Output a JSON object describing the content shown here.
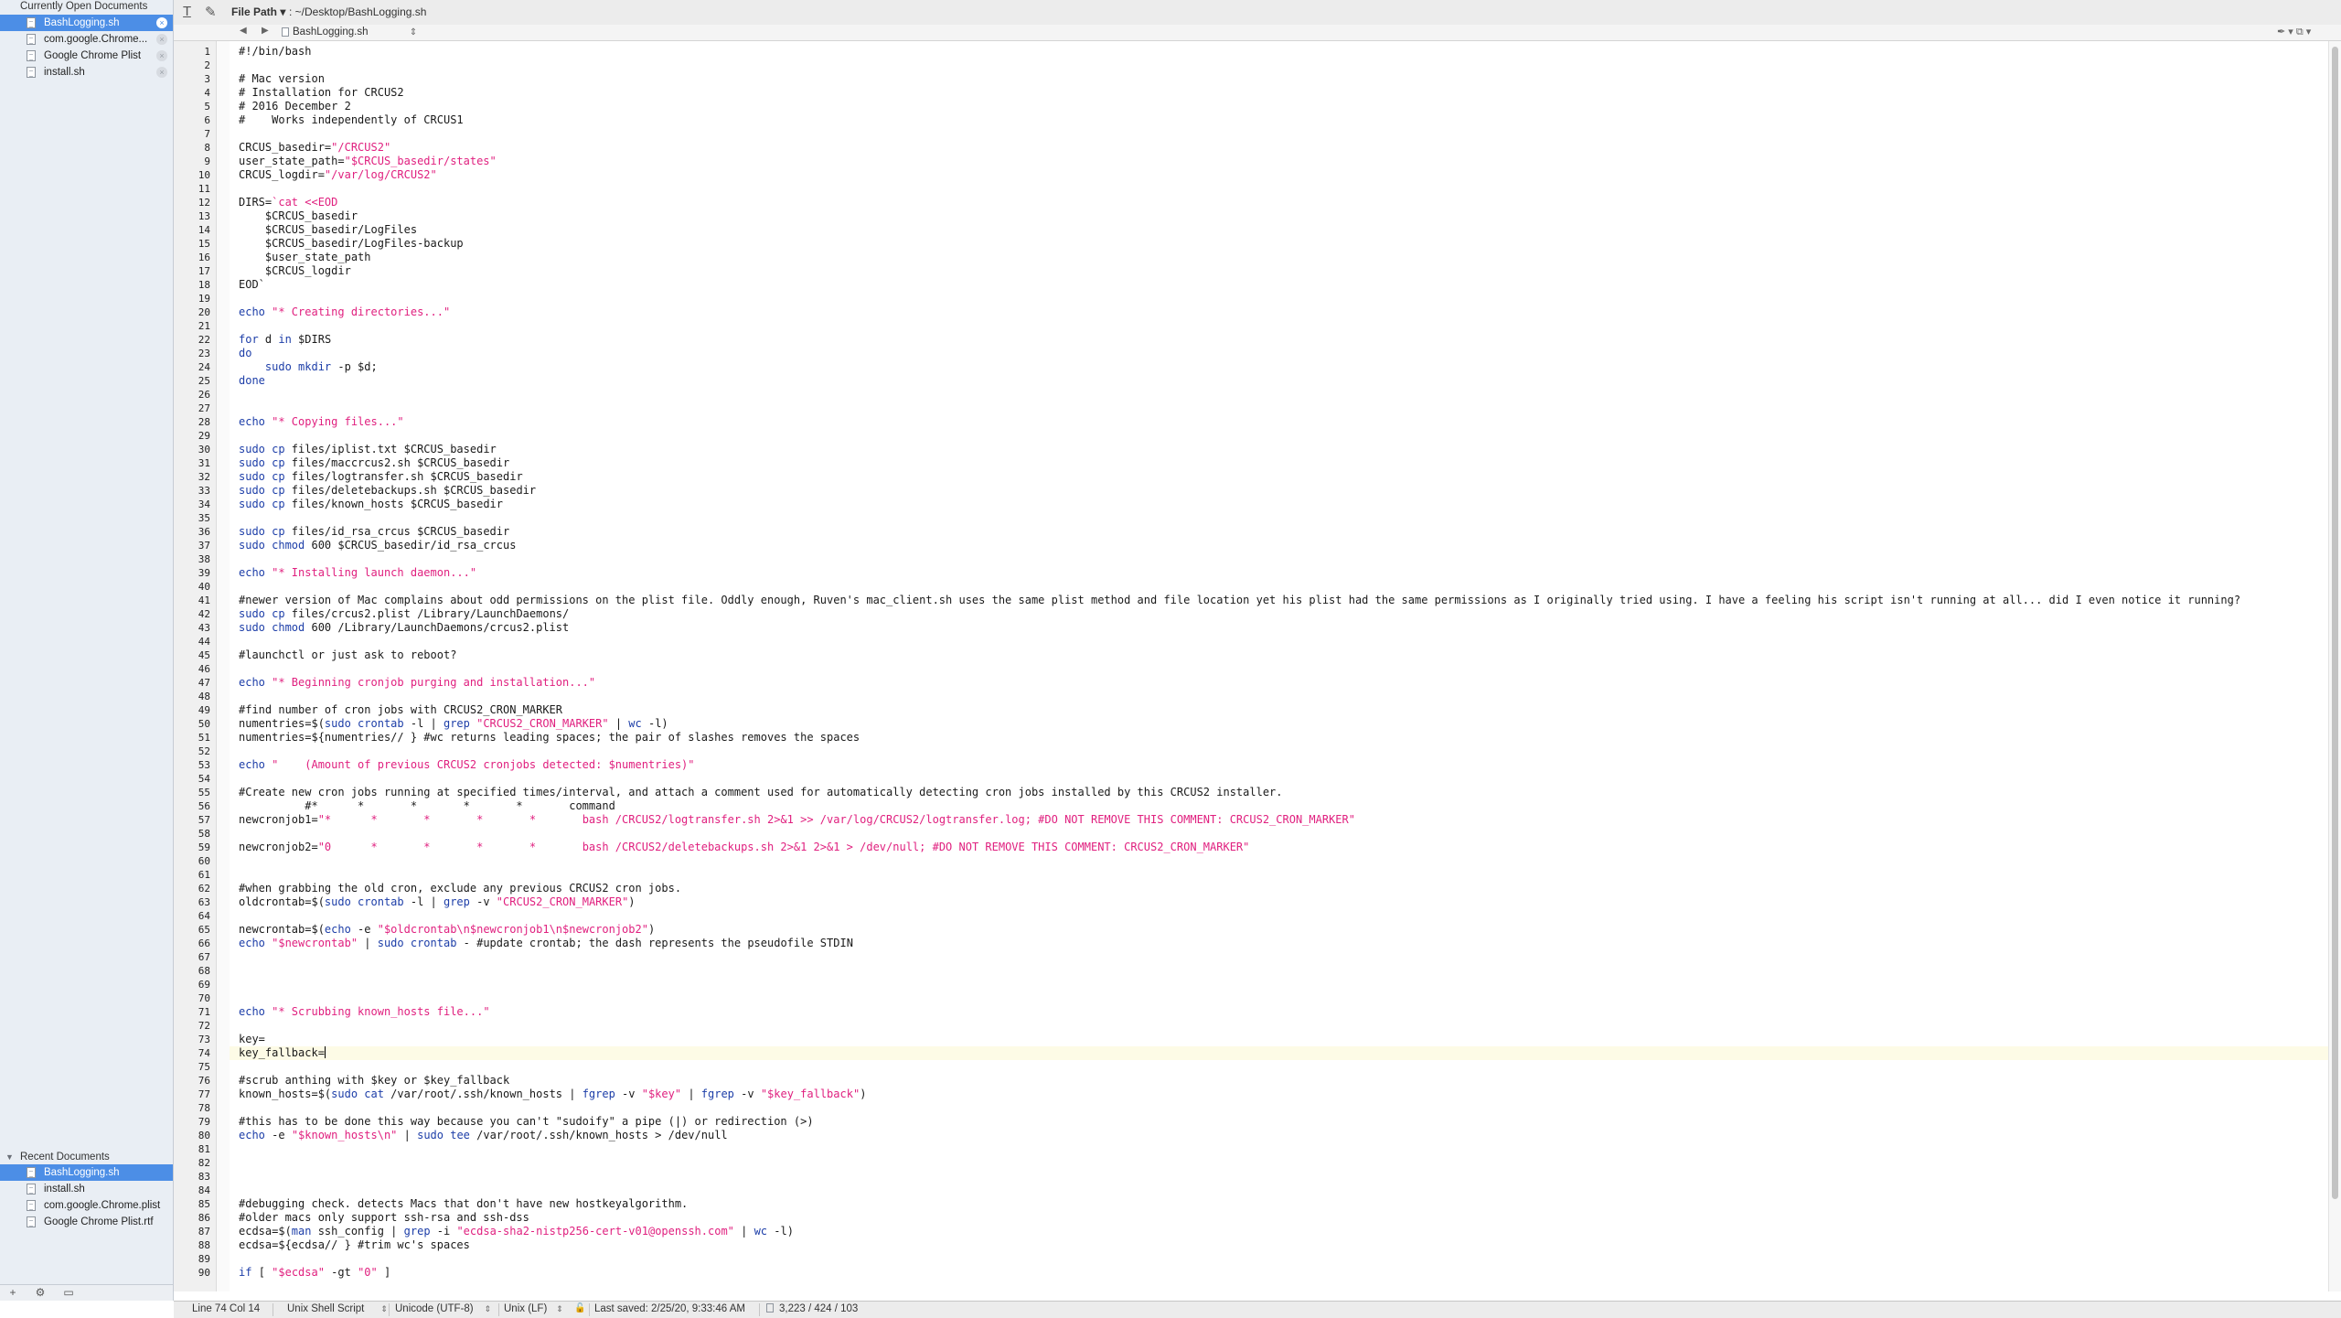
{
  "sidebar": {
    "open_header": "Currently Open Documents",
    "open_documents": [
      {
        "name": "BashLogging.sh",
        "selected": true
      },
      {
        "name": "com.google.Chrome...",
        "selected": false
      },
      {
        "name": "Google Chrome Plist",
        "selected": false
      },
      {
        "name": "install.sh",
        "selected": false
      }
    ],
    "recent_header": "Recent Documents",
    "recent_documents": [
      {
        "name": "BashLogging.sh",
        "selected": true
      },
      {
        "name": "install.sh",
        "selected": false
      },
      {
        "name": "com.google.Chrome.plist",
        "selected": false
      },
      {
        "name": "Google Chrome Plist.rtf",
        "selected": false
      }
    ],
    "footer": {
      "add": "+",
      "gear": "⚙︎",
      "view": "▭"
    }
  },
  "toolbar": {
    "path_label": "File Path ▾",
    "path_value": ": ~/Desktop/BashLogging.sh",
    "text_icon": "T̲",
    "doc_icon": "✎"
  },
  "navbar": {
    "back": "◀",
    "forward": "▶",
    "file_name": "BashLogging.sh",
    "file_menu": "⇕",
    "right_icons": "✒ ▾  ⧉ ▾"
  },
  "editor": {
    "current_line_index": 73,
    "lines": [
      {
        "text": "#!/bin/bash"
      },
      {
        "text": ""
      },
      {
        "text": "# Mac version"
      },
      {
        "text": "# Installation for CRCUS2"
      },
      {
        "text": "# 2016 December 2"
      },
      {
        "text": "#    Works independently of CRCUS1"
      },
      {
        "text": ""
      },
      {
        "segs": [
          [
            "",
            "CRCUS_basedir="
          ],
          [
            "str",
            "\"/CRCUS2\""
          ]
        ]
      },
      {
        "segs": [
          [
            "",
            "user_state_path="
          ],
          [
            "str",
            "\"$CRCUS_basedir/states\""
          ]
        ]
      },
      {
        "segs": [
          [
            "",
            "CRCUS_logdir="
          ],
          [
            "str",
            "\"/var/log/CRCUS2\""
          ]
        ]
      },
      {
        "text": ""
      },
      {
        "segs": [
          [
            "",
            "DIRS="
          ],
          [
            "str",
            "`cat <<EOD"
          ]
        ]
      },
      {
        "text": "    $CRCUS_basedir"
      },
      {
        "text": "    $CRCUS_basedir/LogFiles"
      },
      {
        "text": "    $CRCUS_basedir/LogFiles-backup"
      },
      {
        "text": "    $user_state_path"
      },
      {
        "text": "    $CRCUS_logdir"
      },
      {
        "text": "EOD`"
      },
      {
        "text": ""
      },
      {
        "segs": [
          [
            "kw",
            "echo "
          ],
          [
            "str",
            "\"* Creating directories...\""
          ]
        ]
      },
      {
        "text": ""
      },
      {
        "segs": [
          [
            "kw",
            "for "
          ],
          [
            "",
            "d "
          ],
          [
            "kw",
            "in "
          ],
          [
            "",
            "$DIRS"
          ]
        ]
      },
      {
        "segs": [
          [
            "kw",
            "do"
          ]
        ]
      },
      {
        "segs": [
          [
            "",
            "    "
          ],
          [
            "kw",
            "sudo mkdir"
          ],
          [
            "",
            " -p $d;"
          ]
        ]
      },
      {
        "segs": [
          [
            "kw",
            "done"
          ]
        ]
      },
      {
        "text": ""
      },
      {
        "text": ""
      },
      {
        "segs": [
          [
            "kw",
            "echo "
          ],
          [
            "str",
            "\"* Copying files...\""
          ]
        ]
      },
      {
        "text": ""
      },
      {
        "segs": [
          [
            "kw",
            "sudo cp"
          ],
          [
            "",
            " files/iplist.txt $CRCUS_basedir"
          ]
        ]
      },
      {
        "segs": [
          [
            "kw",
            "sudo cp"
          ],
          [
            "",
            " files/maccrcus2.sh $CRCUS_basedir"
          ]
        ]
      },
      {
        "segs": [
          [
            "kw",
            "sudo cp"
          ],
          [
            "",
            " files/logtransfer.sh $CRCUS_basedir"
          ]
        ]
      },
      {
        "segs": [
          [
            "kw",
            "sudo cp"
          ],
          [
            "",
            " files/deletebackups.sh $CRCUS_basedir"
          ]
        ]
      },
      {
        "segs": [
          [
            "kw",
            "sudo cp"
          ],
          [
            "",
            " files/known_hosts $CRCUS_basedir"
          ]
        ]
      },
      {
        "text": ""
      },
      {
        "segs": [
          [
            "kw",
            "sudo cp"
          ],
          [
            "",
            " files/id_rsa_crcus $CRCUS_basedir"
          ]
        ]
      },
      {
        "segs": [
          [
            "kw",
            "sudo chmod"
          ],
          [
            "",
            " 600 $CRCUS_basedir/id_rsa_crcus"
          ]
        ]
      },
      {
        "text": ""
      },
      {
        "segs": [
          [
            "kw",
            "echo "
          ],
          [
            "str",
            "\"* Installing launch daemon...\""
          ]
        ]
      },
      {
        "text": ""
      },
      {
        "text": "#newer version of Mac complains about odd permissions on the plist file. Oddly enough, Ruven's mac_client.sh uses the same plist method and file location yet his plist had the same permissions as I originally tried using. I have a feeling his script isn't running at all... did I even notice it running?"
      },
      {
        "segs": [
          [
            "kw",
            "sudo cp"
          ],
          [
            "",
            " files/crcus2.plist /Library/LaunchDaemons/"
          ]
        ]
      },
      {
        "segs": [
          [
            "kw",
            "sudo chmod"
          ],
          [
            "",
            " 600 /Library/LaunchDaemons/crcus2.plist"
          ]
        ]
      },
      {
        "text": ""
      },
      {
        "text": "#launchctl or just ask to reboot?"
      },
      {
        "text": ""
      },
      {
        "segs": [
          [
            "kw",
            "echo "
          ],
          [
            "str",
            "\"* Beginning cronjob purging and installation...\""
          ]
        ]
      },
      {
        "text": ""
      },
      {
        "text": "#find number of cron jobs with CRCUS2_CRON_MARKER"
      },
      {
        "segs": [
          [
            "",
            "numentries=$("
          ],
          [
            "kw",
            "sudo crontab"
          ],
          [
            "",
            " -l | "
          ],
          [
            "kw",
            "grep "
          ],
          [
            "str",
            "\"CRCUS2_CRON_MARKER\""
          ],
          [
            "",
            " | "
          ],
          [
            "kw",
            "wc"
          ],
          [
            "",
            " -l)"
          ]
        ]
      },
      {
        "text": "numentries=${numentries// } #wc returns leading spaces; the pair of slashes removes the spaces"
      },
      {
        "text": ""
      },
      {
        "segs": [
          [
            "kw",
            "echo "
          ],
          [
            "str",
            "\"    (Amount of previous CRCUS2 cronjobs detected: $numentries)\""
          ]
        ]
      },
      {
        "text": ""
      },
      {
        "text": "#Create new cron jobs running at specified times/interval, and attach a comment used for automatically detecting cron jobs installed by this CRCUS2 installer."
      },
      {
        "text": "          #*      *       *       *       *       command"
      },
      {
        "segs": [
          [
            "",
            "newcronjob1="
          ],
          [
            "str",
            "\"*      *       *       *       *       bash /CRCUS2/logtransfer.sh 2>&1 >> /var/log/CRCUS2/logtransfer.log; #DO NOT REMOVE THIS COMMENT: CRCUS2_CRON_MARKER\""
          ]
        ]
      },
      {
        "text": ""
      },
      {
        "segs": [
          [
            "",
            "newcronjob2="
          ],
          [
            "str",
            "\"0      *       *       *       *       bash /CRCUS2/deletebackups.sh 2>&1 2>&1 > /dev/null; #DO NOT REMOVE THIS COMMENT: CRCUS2_CRON_MARKER\""
          ]
        ]
      },
      {
        "text": ""
      },
      {
        "text": ""
      },
      {
        "text": "#when grabbing the old cron, exclude any previous CRCUS2 cron jobs."
      },
      {
        "segs": [
          [
            "",
            "oldcrontab=$("
          ],
          [
            "kw",
            "sudo crontab"
          ],
          [
            "",
            " -l | "
          ],
          [
            "kw",
            "grep"
          ],
          [
            "",
            " -v "
          ],
          [
            "str",
            "\"CRCUS2_CRON_MARKER\""
          ],
          [
            "",
            ")"
          ]
        ]
      },
      {
        "text": ""
      },
      {
        "segs": [
          [
            "",
            "newcrontab=$("
          ],
          [
            "kw",
            "echo"
          ],
          [
            "",
            " -e "
          ],
          [
            "str",
            "\"$oldcrontab\\n$newcronjob1\\n$newcronjob2\""
          ],
          [
            "",
            ")"
          ]
        ]
      },
      {
        "segs": [
          [
            "kw",
            "echo "
          ],
          [
            "str",
            "\"$newcrontab\""
          ],
          [
            "",
            " | "
          ],
          [
            "kw",
            "sudo crontab"
          ],
          [
            "",
            " - #update crontab; the dash represents the pseudofile STDIN"
          ]
        ]
      },
      {
        "text": ""
      },
      {
        "text": ""
      },
      {
        "text": ""
      },
      {
        "text": ""
      },
      {
        "segs": [
          [
            "kw",
            "echo "
          ],
          [
            "str",
            "\"* Scrubbing known_hosts file...\""
          ]
        ]
      },
      {
        "text": ""
      },
      {
        "text": "key="
      },
      {
        "text": "key_fallback=",
        "cursor": true
      },
      {
        "text": ""
      },
      {
        "text": "#scrub anthing with $key or $key_fallback"
      },
      {
        "segs": [
          [
            "",
            "known_hosts=$("
          ],
          [
            "kw",
            "sudo cat"
          ],
          [
            "",
            " /var/root/.ssh/known_hosts | "
          ],
          [
            "kw",
            "fgrep"
          ],
          [
            "",
            " -v "
          ],
          [
            "str",
            "\"$key\""
          ],
          [
            "",
            " | "
          ],
          [
            "kw",
            "fgrep"
          ],
          [
            "",
            " -v "
          ],
          [
            "str",
            "\"$key_fallback\""
          ],
          [
            "",
            ")"
          ]
        ]
      },
      {
        "text": ""
      },
      {
        "text": "#this has to be done this way because you can't \"sudoify\" a pipe (|) or redirection (>)"
      },
      {
        "segs": [
          [
            "kw",
            "echo"
          ],
          [
            "",
            " -e "
          ],
          [
            "str",
            "\"$known_hosts\\n\""
          ],
          [
            "",
            " | "
          ],
          [
            "kw",
            "sudo tee"
          ],
          [
            "",
            " /var/root/.ssh/known_hosts > /dev/null"
          ]
        ]
      },
      {
        "text": ""
      },
      {
        "text": ""
      },
      {
        "text": ""
      },
      {
        "text": ""
      },
      {
        "text": "#debugging check. detects Macs that don't have new hostkeyalgorithm."
      },
      {
        "text": "#older macs only support ssh-rsa and ssh-dss"
      },
      {
        "segs": [
          [
            "",
            "ecdsa=$("
          ],
          [
            "kw",
            "man"
          ],
          [
            "",
            " ssh_config | "
          ],
          [
            "kw",
            "grep"
          ],
          [
            "",
            " -i "
          ],
          [
            "str",
            "\"ecdsa-sha2-nistp256-cert-v01@openssh.com\""
          ],
          [
            "",
            " | "
          ],
          [
            "kw",
            "wc"
          ],
          [
            "",
            " -l)"
          ]
        ]
      },
      {
        "text": "ecdsa=${ecdsa// } #trim wc's spaces"
      },
      {
        "text": ""
      },
      {
        "segs": [
          [
            "kw",
            "if "
          ],
          [
            "",
            "[ "
          ],
          [
            "str",
            "\"$ecdsa\""
          ],
          [
            "",
            " -gt "
          ],
          [
            "str",
            "\"0\""
          ],
          [
            "",
            " ]"
          ]
        ]
      }
    ]
  },
  "status": {
    "position": "Line 74 Col 14",
    "syntax": "Unix Shell Script",
    "encoding": "Unicode (UTF-8)",
    "line_endings": "Unix (LF)",
    "lock_icon": "🔓",
    "last_saved": "Last saved: 2/25/20, 9:33:46 AM",
    "stats": "3,223 / 424 / 103"
  }
}
